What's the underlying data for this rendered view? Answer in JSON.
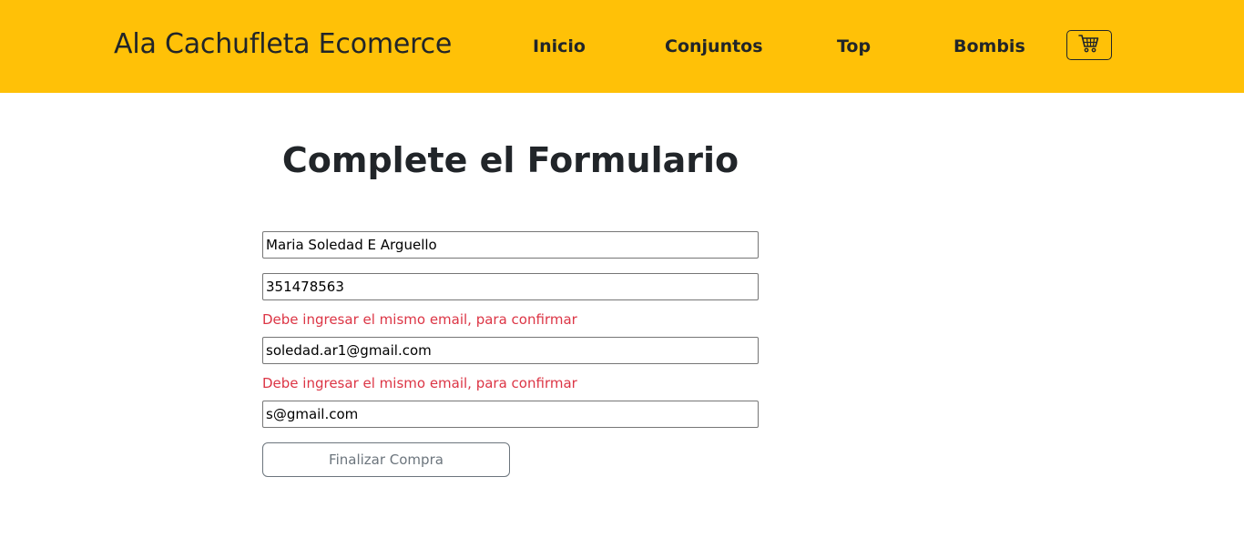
{
  "navbar": {
    "brand": "Ala Cachufleta Ecomerce",
    "links": [
      "Inicio",
      "Conjuntos",
      "Top",
      "Bombis"
    ],
    "cart_icon": "cart-icon",
    "background": "#ffc107"
  },
  "form": {
    "title": "Complete el Formulario",
    "name_value": "Maria Soledad E Arguello",
    "phone_value": "351478563",
    "email_error": "Debe ingresar el mismo email, para confirmar",
    "email_value": "soledad.ar1@gmail.com",
    "confirm_error": "Debe ingresar el mismo email, para confirmar",
    "confirm_value": "s@gmail.com",
    "submit_label": "Finalizar Compra",
    "error_color": "#dc3545"
  }
}
